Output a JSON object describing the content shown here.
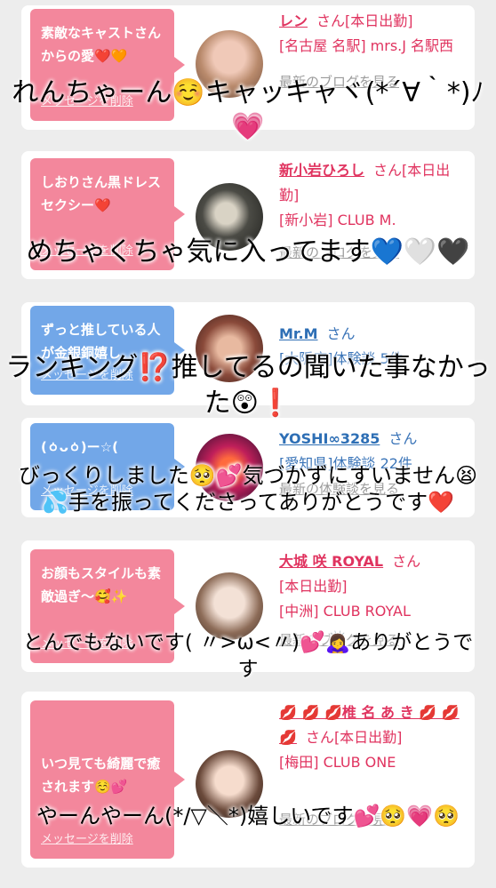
{
  "cards": [
    {
      "message": "素敵なキャストさんからの愛❤️🧡",
      "delete_label": "メッセージを削除",
      "name": "レン",
      "honorific": "さん",
      "detail_line1": "[本日出勤]",
      "detail_line2": "[名古屋 名駅] mrs.J 名駅西",
      "link": "最新のブログを見る",
      "bubble_color": "#f3879c"
    },
    {
      "message": "しおりさん黒ドレスセクシー❤️",
      "delete_label": "メッセージを削除",
      "name": "新小岩ひろし",
      "honorific": "さん",
      "detail_line1": "[本日出勤]",
      "detail_line2": "[新小岩] CLUB M.",
      "link": "最新のブログを見る",
      "bubble_color": "#f3879c"
    },
    {
      "message": "ずっと推している人が金銀銅嬉し",
      "delete_label": "メッセージを削除",
      "name": "Mr.M",
      "honorific": "さん",
      "detail_line1": "[大阪府]体験談 5件",
      "detail_line2": "",
      "link": "",
      "bubble_color": "#72a7e8"
    },
    {
      "message": "(ㆁᴗㆁ)ー☆(",
      "delete_label": "メッセージを削除",
      "name": "YOSHI∞3285",
      "honorific": "さん",
      "detail_line1": "[愛知県]体験談 22件",
      "detail_line2": "",
      "link": "最新の体験談を見る",
      "bubble_color": "#72a7e8"
    },
    {
      "message": "お顔もスタイルも素敵過ぎ〜🥰✨",
      "delete_label": "メッセージを削除",
      "name": "大城 咲 ROYAL",
      "honorific": "さん",
      "detail_line1": "[本日出勤]",
      "detail_line2": "[中洲] CLUB ROYAL",
      "link": "最新のブログを見る",
      "bubble_color": "#f3879c"
    },
    {
      "message": "いつ見ても綺麗で癒されます☺️💕",
      "delete_label": "メッセージを削除",
      "name": "💋 💋 💋椎 名 あ き 💋 💋 💋",
      "honorific": "さん",
      "detail_line1": "[本日出勤]",
      "detail_line2": "[梅田] CLUB ONE",
      "link": "最新のブログを見る",
      "bubble_color": "#f3879c"
    }
  ],
  "overlays": [
    "れんちゃーん☺️キャッキャヾ(*´∀｀*)ﾉ💗",
    "めちゃくちゃ気に入ってます💙🤍🖤",
    "ランキング⁉️推してるの聞いた事なかった😲❗️",
    "びっくりしました🥺💕気づかずにすいません😫💦手を振ってくださってありがとうです❤️",
    "とんでもないです( 〃>ω<〃)💕🙇‍♀️ありがとうです",
    "やーんやーん(*/▽＼*)嬉しいです💕🥺💗🥺"
  ]
}
